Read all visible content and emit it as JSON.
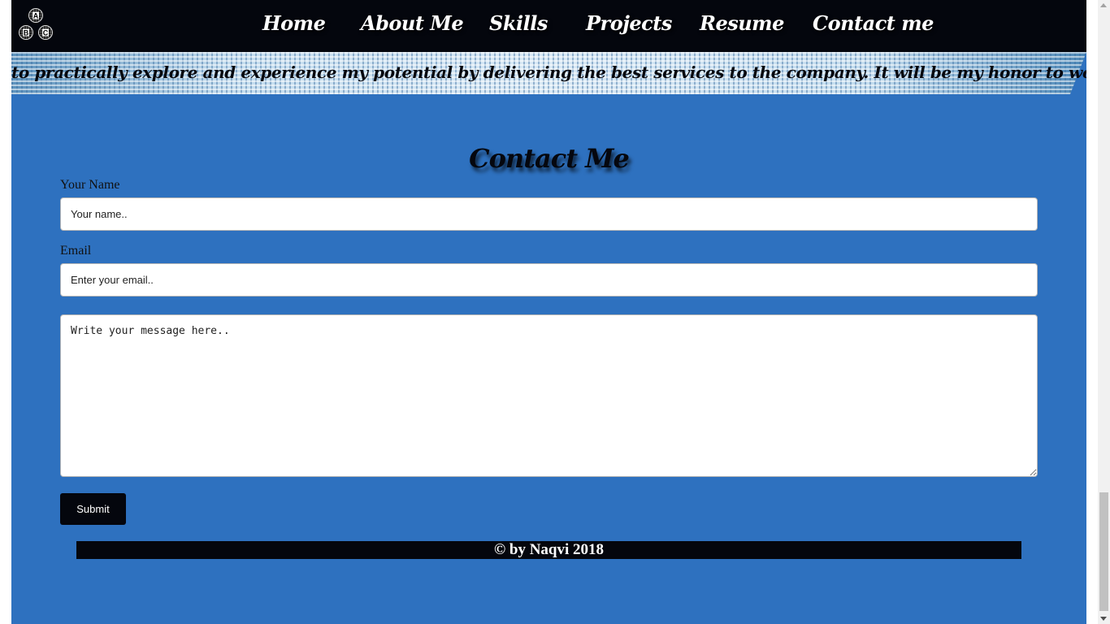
{
  "nav": {
    "logo_letters": [
      "A",
      "B",
      "C"
    ],
    "items": [
      {
        "label": "Home"
      },
      {
        "label": "About Me"
      },
      {
        "label": "Skills"
      },
      {
        "label": "Projects"
      },
      {
        "label": "Resume"
      },
      {
        "label": "Contact me"
      }
    ]
  },
  "banner": {
    "text": "to practically explore and experience my potential by delivering the best services to the company. It will be my honor to work with you."
  },
  "contact": {
    "title": "Contact Me",
    "name_label": "Your Name",
    "name_placeholder": "Your name..",
    "email_label": "Email",
    "email_placeholder": "Enter your email..",
    "message_placeholder": "Write your message here..",
    "submit_label": "Submit"
  },
  "footer": {
    "text": "© by Naqvi 2018"
  },
  "colors": {
    "nav_background": "#04060d",
    "section_background": "#2e71bf",
    "button_background": "#04060d"
  },
  "scrollbar": {
    "scroll_position": 1.0
  }
}
